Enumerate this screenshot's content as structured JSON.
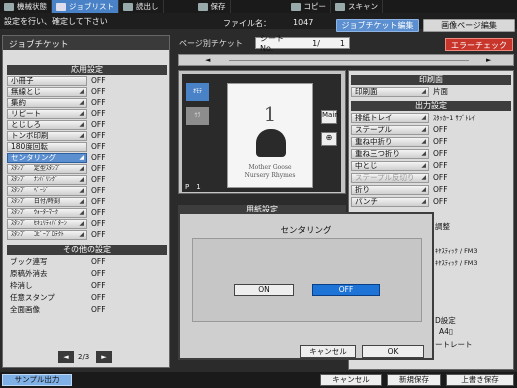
{
  "topbar": {
    "tabs": [
      {
        "label": "機械状態",
        "icon": "machine-icon"
      },
      {
        "label": "ジョブリスト",
        "icon": "joblist-icon"
      },
      {
        "label": "読出し",
        "icon": "read-icon"
      },
      {
        "label": "保存",
        "icon": "save-icon"
      },
      {
        "label": "コピー",
        "icon": "copy-icon"
      },
      {
        "label": "スキャン",
        "icon": "scan-icon"
      }
    ]
  },
  "message": {
    "text": "設定を行い、確定して下さい",
    "file_label": "ファイル名：",
    "file_value": "1047"
  },
  "view_tabs": {
    "job_ticket_edit": "ジョブチケット編集",
    "image_page_edit": "画像ページ編集"
  },
  "left_panel": {
    "title": "ジョブチケット",
    "sections": {
      "applied": "応用設定",
      "other": "その他の設定"
    },
    "applied_rows": [
      {
        "label": "小冊子",
        "value": "OFF"
      },
      {
        "label": "無線とじ",
        "value": "OFF"
      },
      {
        "label": "集約",
        "value": "OFF"
      },
      {
        "label": "リピート",
        "value": "OFF"
      },
      {
        "label": "とじしろ",
        "value": "OFF"
      },
      {
        "label": "トンボ印刷",
        "value": "OFF"
      },
      {
        "label": "180度回転",
        "value": "OFF"
      },
      {
        "label": "センタリング",
        "value": "OFF"
      },
      {
        "label": "ｽﾀﾝﾌﾟ　 定型ｽﾀﾝﾌﾟ",
        "value": "OFF"
      },
      {
        "label": "ｽﾀﾝﾌﾟ　 ﾅﾝﾊﾞﾘﾝｸﾞ",
        "value": "OFF"
      },
      {
        "label": "ｽﾀﾝﾌﾟ　 ﾍﾟｰｼﾞ",
        "value": "OFF"
      },
      {
        "label": "ｽﾀﾝﾌﾟ　 日付/時刻",
        "value": "OFF"
      },
      {
        "label": "ｽﾀﾝﾌﾟ　 ｳｫｰﾀｰﾏｰｸ",
        "value": "OFF"
      },
      {
        "label": "ｽﾀﾝﾌﾟ　 ｾｷｭﾘﾃｨﾊﾟﾀｰﾝ",
        "value": "OFF"
      },
      {
        "label": "ｽﾀﾝﾌﾟ　 ｺﾋﾟｰﾌﾟﾛﾃｸﾄ",
        "value": "OFF"
      }
    ],
    "other_rows": [
      {
        "label": "ブック連写",
        "value": "OFF"
      },
      {
        "label": "原稿外消去",
        "value": "OFF"
      },
      {
        "label": "枠消し",
        "value": "OFF"
      },
      {
        "label": "任意スタンプ",
        "value": "OFF"
      },
      {
        "label": "全面画像",
        "value": "OFF"
      }
    ],
    "pager": {
      "prev": "◄",
      "page": "2/3",
      "next": "►"
    }
  },
  "page_ticket": {
    "label": "ページ別チケット",
    "sheet_label": "シートNo.",
    "sheet_value": "1/",
    "sheet_total": "1",
    "error_check": "エラーチェック",
    "scroll_left": "◄",
    "scroll_right": "►"
  },
  "preview": {
    "thumb_selected": "ｵﾓﾃ",
    "thumb_other": "ｳﾗ",
    "page_number": "1",
    "page_title_line1": "Mother Goose",
    "page_title_line2": "Nursery Rhymes",
    "page_label": "P　1",
    "zoom_main": "Main",
    "zoom_in": "⊕"
  },
  "paper_section": "用紙設定",
  "right_panel": {
    "print_side_section": "印刷面",
    "print_side": {
      "label": "印刷面",
      "value": "片面"
    },
    "output_section": "出力設定",
    "output_rows": [
      {
        "label": "排紙トレイ",
        "value": "ｽﾀｯｶｰ1 ｻﾌﾞﾄﾚｲ",
        "enabled": true
      },
      {
        "label": "ステープル",
        "value": "OFF",
        "enabled": true
      },
      {
        "label": "重ね中折り",
        "value": "OFF",
        "enabled": true
      },
      {
        "label": "重ね三つ折り",
        "value": "OFF",
        "enabled": true
      },
      {
        "label": "中とじ",
        "value": "OFF",
        "enabled": true
      },
      {
        "label": "ステープル反切り",
        "value": "OFF",
        "enabled": false
      },
      {
        "label": "折り",
        "value": "OFF",
        "enabled": true
      },
      {
        "label": "パンチ",
        "value": "OFF",
        "enabled": true
      }
    ],
    "partial": [
      {
        "value": "調整"
      },
      {
        "value": "ｷﾔｽﾃｨｯｸ / FM3"
      },
      {
        "value": "ｷﾔｽﾃｨｯｸ / FM3"
      },
      {
        "value": "D設定"
      },
      {
        "value": "A4▯"
      },
      {
        "value": "ートレート"
      }
    ]
  },
  "dialog": {
    "title": "センタリング",
    "on_label": "ON",
    "off_label": "OFF",
    "cancel_label": "キャンセル",
    "ok_label": "OK",
    "selected": "OFF"
  },
  "bottombar": {
    "sample_output": "サンプル出力",
    "cancel": "キャンセル",
    "new_save": "新規保存",
    "overwrite_save": "上書き保存"
  },
  "colors": {
    "accent": "#4a82c7",
    "selected": "#1e73d6",
    "error": "#c8352b"
  }
}
